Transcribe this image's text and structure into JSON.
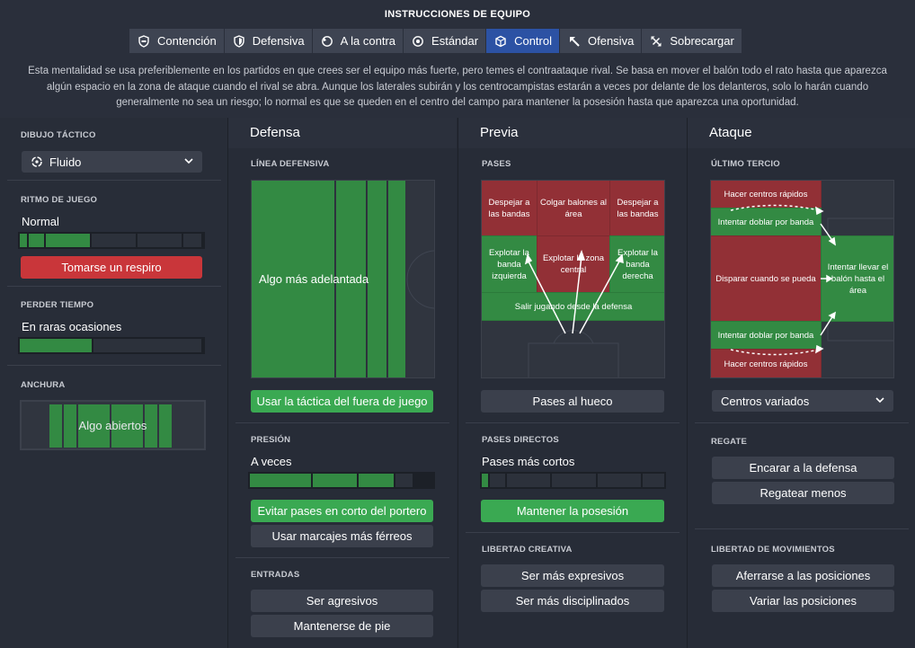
{
  "header": {
    "title": "INSTRUCCIONES DE EQUIPO",
    "tabs": [
      {
        "label": "Contención",
        "icon": "contencion-icon"
      },
      {
        "label": "Defensiva",
        "icon": "shield-icon"
      },
      {
        "label": "A la contra",
        "icon": "counter-icon"
      },
      {
        "label": "Estándar",
        "icon": "target-icon"
      },
      {
        "label": "Control",
        "icon": "cube-icon",
        "active": true
      },
      {
        "label": "Ofensiva",
        "icon": "arrow-up-left-icon"
      },
      {
        "label": "Sobrecargar",
        "icon": "overload-icon"
      }
    ],
    "description": "Esta mentalidad se usa preferiblemente en los partidos en que crees ser el equipo más fuerte, pero temes el contraataque rival. Se basa en mover el balón todo el rato hasta que aparezca algún espacio en la zona de ataque cuando el rival se abra. Aunque los laterales subirán y los centrocampistas estarán a veces por delante de los delanteros, solo lo harán cuando generalmente no sea un riesgo; lo normal es que se queden en el centro del campo para mantener la posesión hasta que aparezca una oportunidad."
  },
  "sidebar": {
    "formation_label": "DIBUJO TÁCTICO",
    "formation_value": "Fluido",
    "tempo_label": "RITMO DE JUEGO",
    "tempo_value": "Normal",
    "tempo_level": 0.45,
    "tempo_button": "Tomarse un respiro",
    "time_wasting_label": "PERDER TIEMPO",
    "time_wasting_value": "En raras ocasiones",
    "time_wasting_level": 0.4,
    "width_label": "ANCHURA",
    "width_value": "Algo abiertos"
  },
  "defense": {
    "title": "Defensa",
    "line_label": "LÍNEA DEFENSIVA",
    "line_value": "Algo más adelantada",
    "offside_button": "Usar la táctica del fuera de juego",
    "press_label": "PRESIÓN",
    "press_value": "A veces",
    "press_level": 0.8,
    "press_btn1": "Evitar pases en corto del portero",
    "press_btn2": "Usar marcajes más férreos",
    "tackle_label": "ENTRADAS",
    "tackle_btn1": "Ser agresivos",
    "tackle_btn2": "Mantenerse de pie"
  },
  "buildup": {
    "title": "Previa",
    "passes_label": "PASES",
    "cells": {
      "clear_left": "Despejar a las bandas",
      "lob_area": "Colgar balones al área",
      "clear_right": "Despejar a las bandas",
      "exploit_left": "Explotar la banda izquierda",
      "exploit_center": "Explotar la zona central",
      "exploit_right": "Explotar la banda derecha",
      "play_out": "Salir jugando desde la defensa"
    },
    "through_button": "Pases al hueco",
    "directness_label": "PASES DIRECTOS",
    "directness_value": "Pases más cortos",
    "directness_level": 0.1,
    "possession_button": "Mantener la posesión",
    "creative_label": "LIBERTAD CREATIVA",
    "creative_btn1": "Ser más expresivos",
    "creative_btn2": "Ser más disciplinados"
  },
  "attack": {
    "title": "Ataque",
    "final_third_label": "ÚLTIMO TERCIO",
    "cells": {
      "cross_fast_top": "Hacer centros rápidos",
      "overlap_top": "Intentar doblar por banda",
      "shoot": "Disparar cuando se pueda",
      "work_in": "Intentar llevar el balón hasta el área",
      "overlap_bottom": "Intentar doblar por banda",
      "cross_fast_bottom": "Hacer centros rápidos"
    },
    "cross_select": "Centros variados",
    "dribble_label": "REGATE",
    "dribble_btn1": "Encarar a la defensa",
    "dribble_btn2": "Regatear menos",
    "movement_label": "LIBERTAD DE MOVIMIENTOS",
    "movement_btn1": "Aferrarse a las posiciones",
    "movement_btn2": "Variar las posiciones"
  }
}
